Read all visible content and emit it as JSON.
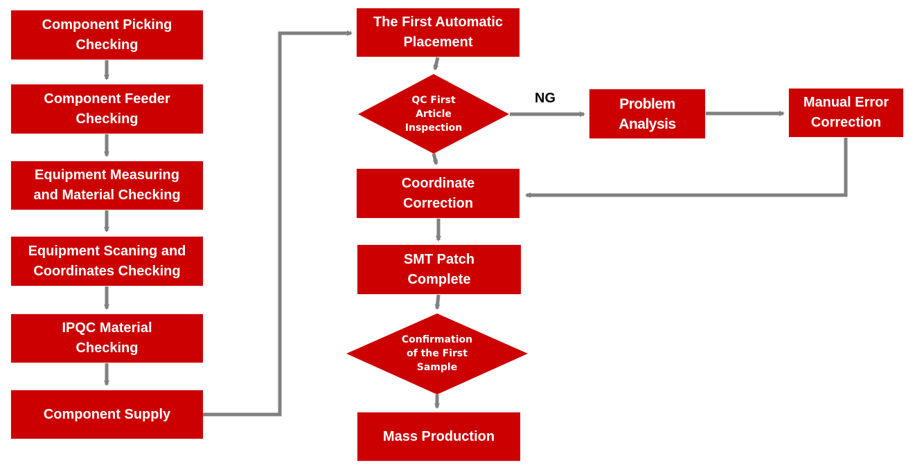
{
  "colors": {
    "node": "#cc0000",
    "connector": "#808080",
    "text": "#ffffff",
    "label": "#000000"
  },
  "left_column": [
    {
      "id": "component-picking-checking",
      "label": "Component Picking\nChecking"
    },
    {
      "id": "component-feeder-checking",
      "label": "Component Feeder\nChecking"
    },
    {
      "id": "equipment-measuring",
      "label": "Equipment Measuring\nand Material Checking"
    },
    {
      "id": "equipment-scaning",
      "label": "Equipment Scaning and\nCoordinates Checking"
    },
    {
      "id": "ipqc-material-checking",
      "label": "IPQC Material\nChecking"
    },
    {
      "id": "component-supply",
      "label": "Component Supply"
    }
  ],
  "center_column": {
    "first_placement": "The First Automatic\nPlacement",
    "qc_decision": "QC First\nArticle\nInspection",
    "coordinate_correction": "Coordinate\nCorrection",
    "smt_patch": "SMT Patch\nComplete",
    "confirmation_decision": "Confirmation\nof the First\nSample",
    "mass_production": "Mass Production"
  },
  "right_branch": {
    "ng_label": "NG",
    "problem_analysis": "Problem\nAnalysis",
    "manual_error_correction": "Manual Error\nCorrection"
  }
}
